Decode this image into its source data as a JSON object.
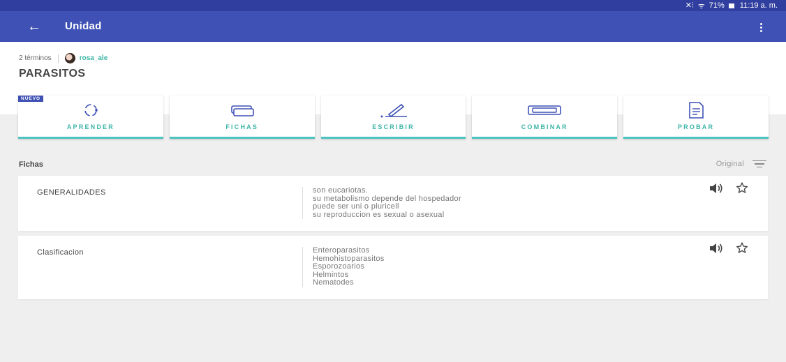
{
  "status_bar": {
    "signal": "✕⫶",
    "wifi": "ᯤ",
    "battery": "71%",
    "time": "11:19 a. m."
  },
  "app_bar": {
    "back_glyph": "←",
    "title": "Unidad"
  },
  "set": {
    "term_count": "2 términos",
    "author": "rosa_ale",
    "title": "PARASITOS"
  },
  "modes": [
    {
      "label": "APRENDER",
      "badge": "NUEVO",
      "icon": "learn-icon"
    },
    {
      "label": "FICHAS",
      "icon": "flashcards-icon"
    },
    {
      "label": "ESCRIBIR",
      "icon": "write-icon"
    },
    {
      "label": "COMBINAR",
      "icon": "match-icon"
    },
    {
      "label": "PROBAR",
      "icon": "test-icon"
    }
  ],
  "terms_section": {
    "title": "Fichas",
    "sort_label": "Original"
  },
  "terms": [
    {
      "word": "GENERALIDADES",
      "definition": [
        "son eucariotas.",
        "su metabolismo depende del hospedador",
        "puede ser uni o pluricell",
        "su reproduccion es sexual o asexual"
      ]
    },
    {
      "word": "Clasificacion",
      "definition": [
        "Enteroparasitos",
        "Hemohistoparasitos",
        "Esporozoarios",
        "Helmintos",
        "Nematodes"
      ]
    }
  ],
  "colors": {
    "app_bar": "#3f51b5",
    "status_bar": "#303f9f",
    "accent": "#3db5a8",
    "mode_underline": "#4fc3c0"
  }
}
